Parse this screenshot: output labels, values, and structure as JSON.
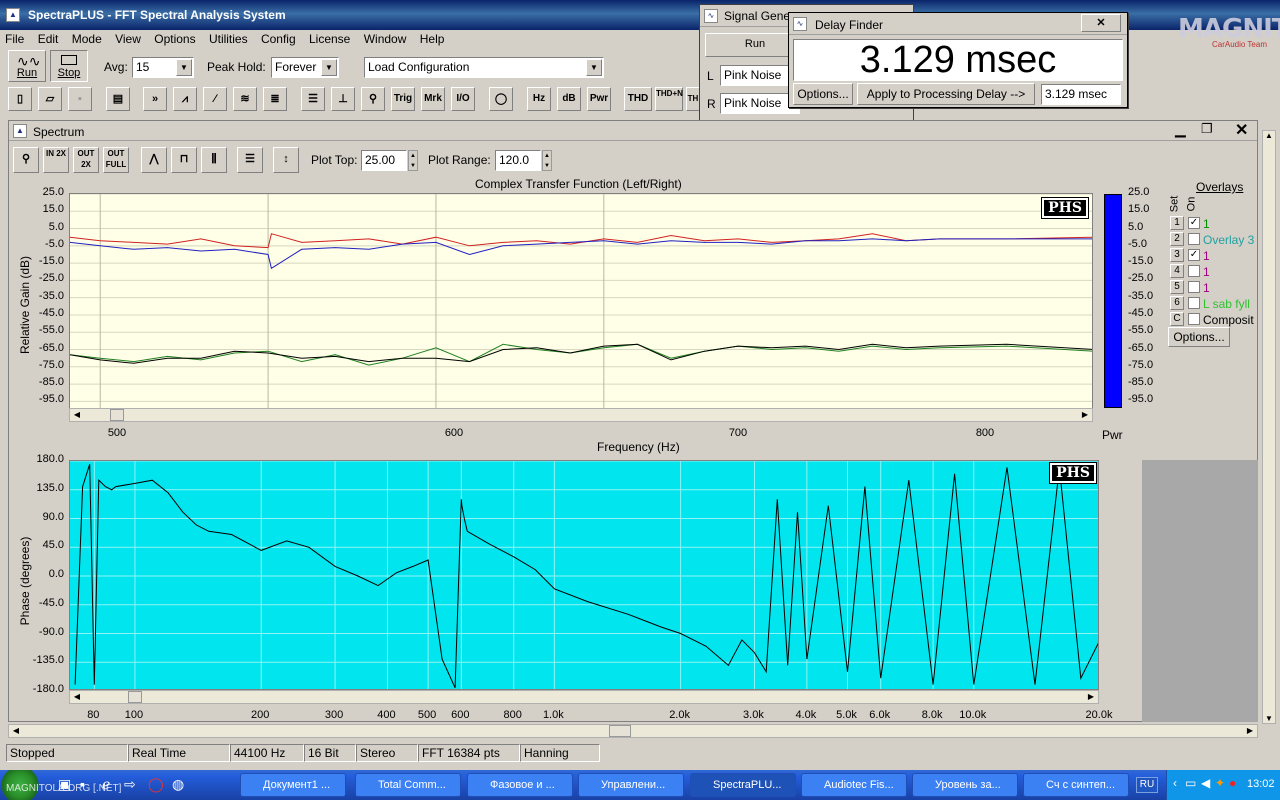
{
  "app": {
    "title": "SpectraPLUS - FFT Spectral Analysis System"
  },
  "menu": [
    "File",
    "Edit",
    "Mode",
    "View",
    "Options",
    "Utilities",
    "Config",
    "License",
    "Window",
    "Help"
  ],
  "toolbar": {
    "run_label": "Run",
    "stop_label": "Stop",
    "avg_label": "Avg:",
    "avg_value": "15",
    "peak_hold_label": "Peak Hold:",
    "peak_hold_value": "Forever",
    "config_value": "Load Configuration",
    "buttons2": [
      "Trig",
      "Mrk",
      "I/O",
      "Hz",
      "dB",
      "Pwr",
      "THD",
      "THD+N",
      "TH"
    ]
  },
  "signal_generator": {
    "title": "Signal Genera",
    "run_label": "Run",
    "left_label": "L",
    "right_label": "R",
    "left_value": "Pink Noise",
    "right_value": "Pink Noise"
  },
  "delay_finder": {
    "title": "Delay Finder",
    "value": "3.129 msec",
    "options_label": "Options...",
    "apply_label": "Apply to Processing Delay -->",
    "field_value": "3.129 msec"
  },
  "watermark": {
    "line1": "MAGNITOLA",
    "line2": "CarAudio Team"
  },
  "spectrum": {
    "title": "Spectrum",
    "plot_top_label": "Plot Top:",
    "plot_top_value": "25.00",
    "plot_range_label": "Plot Range:",
    "plot_range_value": "120.0",
    "zoom_labels": [
      "IN 2X",
      "OUT 2X",
      "OUT FULL"
    ],
    "top_chart_title": "Complex Transfer Function (Left/Right)",
    "top_ylabel": "Relative Gain (dB)",
    "top_yticks": [
      "25.0",
      "15.0",
      "5.0",
      "-5.0",
      "-15.0",
      "-25.0",
      "-35.0",
      "-45.0",
      "-55.0",
      "-65.0",
      "-75.0",
      "-85.0",
      "-95.0"
    ],
    "top_xticks": [
      "500",
      "600",
      "700",
      "800"
    ],
    "xlabel": "Frequency (Hz)",
    "phs_label": "PHS",
    "pwr_label": "Pwr",
    "bar_ticks": [
      "25.0",
      "15.0",
      "5.0",
      "-5.0",
      "-15.0",
      "-25.0",
      "-35.0",
      "-45.0",
      "-55.0",
      "-65.0",
      "-75.0",
      "-85.0",
      "-95.0"
    ],
    "bottom_ylabel": "Phase (degrees)",
    "bottom_yticks": [
      "180.0",
      "135.0",
      "90.0",
      "45.0",
      "0.0",
      "-45.0",
      "-90.0",
      "-135.0",
      "-180.0"
    ],
    "bottom_xticks": [
      "80",
      "100",
      "200",
      "300",
      "400",
      "500",
      "600",
      "800",
      "1.0k",
      "2.0k",
      "3.0k",
      "4.0k",
      "5.0k",
      "6.0k",
      "8.0k",
      "10.0k",
      "20.0k"
    ]
  },
  "overlays": {
    "title": "Overlays",
    "set_label": "Set",
    "on_label": "On",
    "rows": [
      {
        "set": "1",
        "checked": "✓",
        "name": "1",
        "color": "#009000"
      },
      {
        "set": "2",
        "checked": "",
        "name": "Overlay 3",
        "color": "#20a0a0"
      },
      {
        "set": "3",
        "checked": "✓",
        "name": "1",
        "color": "#a00080"
      },
      {
        "set": "4",
        "checked": "",
        "name": "1",
        "color": "#a00080"
      },
      {
        "set": "5",
        "checked": "",
        "name": "1",
        "color": "#a00080"
      },
      {
        "set": "6",
        "checked": "",
        "name": "L sab fyll",
        "color": "#30c030"
      },
      {
        "set": "C",
        "checked": "",
        "name": "Composit",
        "color": "#000000"
      }
    ],
    "options_label": "Options..."
  },
  "status": [
    "Stopped",
    "Real Time",
    "44100 Hz",
    "16 Bit",
    "Stereo",
    "FFT 16384 pts",
    "Hanning"
  ],
  "taskbar": {
    "watermark": "MAGNITOLA.ORG [.NET]",
    "tasks": [
      "Документ1 ...",
      "Total Comm...",
      "Фазовое и ...",
      "Управлени...",
      "SpectraPLU...",
      "Audiotec Fis...",
      "Уровень за...",
      "Сч с синтеп..."
    ],
    "lang": "RU",
    "clock": "13:02"
  },
  "chart_data": [
    {
      "type": "line",
      "title": "Complex Transfer Function (Left/Right)",
      "xlabel": "Frequency (Hz)",
      "ylabel": "Relative Gain (dB)",
      "xlim": [
        482,
        1092
      ],
      "ylim": [
        -100,
        25
      ],
      "series": [
        {
          "color": "#d02020",
          "x": [
            482,
            500,
            520,
            540,
            560,
            580,
            600,
            602,
            620,
            640,
            660,
            680,
            700,
            720,
            740,
            760,
            780,
            800,
            820,
            840,
            860,
            880,
            900,
            920,
            940,
            960,
            980,
            1000,
            1040,
            1092
          ],
          "y": [
            0,
            -2,
            -3,
            -4,
            -1,
            -5,
            -6,
            2,
            -3,
            -2,
            -1,
            -4,
            0,
            -5,
            -3,
            -2,
            -4,
            -1,
            -3,
            1,
            -2,
            -1,
            -3,
            -2,
            -1,
            2,
            -2,
            -1,
            -1,
            0
          ]
        },
        {
          "color": "#2020c0",
          "x": [
            482,
            500,
            520,
            540,
            560,
            580,
            600,
            602,
            620,
            640,
            660,
            680,
            700,
            720,
            740,
            760,
            780,
            800,
            820,
            840,
            860,
            880,
            900,
            920,
            940,
            960,
            980,
            1000,
            1040,
            1092
          ],
          "y": [
            -3,
            -5,
            -7,
            -6,
            -8,
            -7,
            -10,
            -18,
            -7,
            -6,
            -7,
            -4,
            -3,
            -10,
            -5,
            -4,
            -3,
            -2,
            -4,
            -2,
            -3,
            -3,
            -4,
            -2,
            -2,
            -1,
            -2,
            -1,
            -1,
            -1
          ]
        },
        {
          "color": "#208020",
          "x": [
            482,
            500,
            520,
            540,
            560,
            580,
            600,
            620,
            640,
            660,
            680,
            700,
            720,
            740,
            760,
            780,
            800,
            820,
            840,
            860,
            880,
            900,
            920,
            940,
            960,
            980,
            1000,
            1040,
            1092
          ],
          "y": [
            -68,
            -70,
            -72,
            -69,
            -71,
            -67,
            -66,
            -72,
            -68,
            -74,
            -70,
            -64,
            -72,
            -62,
            -65,
            -67,
            -64,
            -62,
            -70,
            -66,
            -63,
            -65,
            -64,
            -66,
            -63,
            -65,
            -64,
            -63,
            -66
          ]
        },
        {
          "color": "#000000",
          "x": [
            482,
            500,
            520,
            540,
            560,
            580,
            600,
            620,
            640,
            660,
            680,
            700,
            720,
            740,
            760,
            780,
            800,
            820,
            840,
            860,
            880,
            900,
            920,
            940,
            960,
            980,
            1000,
            1040,
            1092
          ],
          "y": [
            -68,
            -71,
            -73,
            -70,
            -70,
            -66,
            -67,
            -70,
            -69,
            -72,
            -70,
            -70,
            -72,
            -65,
            -64,
            -67,
            -63,
            -62,
            -71,
            -66,
            -63,
            -64,
            -63,
            -65,
            -62,
            -64,
            -63,
            -62,
            -65
          ]
        }
      ]
    },
    {
      "type": "line",
      "xlabel": "",
      "ylabel": "Phase (degrees)",
      "xlim": [
        70,
        20000
      ],
      "ylim": [
        -180,
        180
      ],
      "x_scale": "log",
      "series": [
        {
          "color": "#000000",
          "x": [
            72,
            75,
            78,
            80,
            82,
            85,
            88,
            90,
            100,
            110,
            120,
            130,
            140,
            150,
            170,
            200,
            230,
            260,
            300,
            340,
            380,
            420,
            460,
            500,
            540,
            580,
            600,
            602,
            610,
            620,
            700,
            800,
            900,
            1000,
            1200,
            1500,
            1800,
            2000,
            2300,
            2600,
            2800,
            3000,
            3200,
            3400,
            3600,
            3800,
            4000,
            4500,
            5000,
            5500,
            6000,
            7000,
            8000,
            9000,
            10000,
            12000,
            14000,
            16000,
            18000,
            20000
          ],
          "y": [
            -170,
            140,
            175,
            -170,
            150,
            140,
            135,
            140,
            145,
            150,
            130,
            100,
            80,
            70,
            65,
            40,
            55,
            45,
            15,
            0,
            -15,
            5,
            15,
            25,
            -130,
            -175,
            120,
            110,
            90,
            70,
            50,
            30,
            10,
            -20,
            -40,
            -60,
            -80,
            -90,
            -110,
            -140,
            -100,
            -120,
            -150,
            120,
            -140,
            100,
            -130,
            110,
            -150,
            140,
            -160,
            150,
            -170,
            160,
            -170,
            170,
            -170,
            170,
            -160,
            -100
          ]
        }
      ]
    }
  ]
}
